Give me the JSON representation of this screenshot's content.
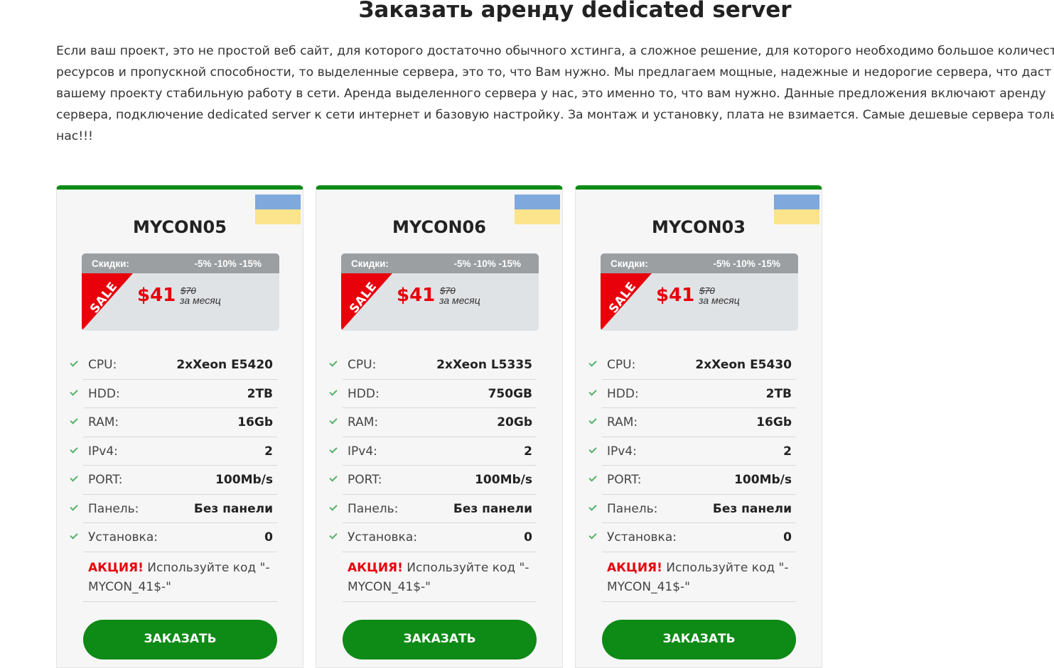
{
  "page": {
    "title": "Заказать аренду dedicated server",
    "intro": "Если ваш проект, это не простой веб сайт, для которого достаточно обычного хстинга, а сложное решение, для которого необходимо большое количест ресурсов и пропускной способности, то выделенные сервера, это то, что Вам нужно. Мы предлагаем мощные, надежные и недорогие сервера, что даст вашему проекту стабильную работу в сети. Аренда выделенного сервера у нас, это именно то, что вам нужно. Данные предложения включают аренду сервера, подключение dedicated server к сети интернет и базовую настройку. За монтаж и установку, плата не взимается. Самые дешевые сервера тольк нас!!!"
  },
  "colors": {
    "accent_green": "#0e8a16",
    "sale_red": "#e8000b",
    "flag_blue": "#7fa8dd",
    "flag_yellow": "#fbe48c"
  },
  "cards": [
    {
      "name": "MYCON05",
      "flag_icon": "ukraine-flag-icon",
      "discount_label": "Скидки:",
      "discount_values": "-5% -10% -15%",
      "sale_badge": "SALE",
      "price_new": "$41",
      "price_old": "$70",
      "price_period": "за месяц",
      "specs": [
        {
          "label": "CPU:",
          "value": "2xXeon E5420"
        },
        {
          "label": "HDD:",
          "value": "2TB"
        },
        {
          "label": "RAM:",
          "value": "16Gb"
        },
        {
          "label": "IPv4:",
          "value": "2"
        },
        {
          "label": "PORT:",
          "value": "100Mb/s"
        },
        {
          "label": "Панель:",
          "value": "Без панели"
        },
        {
          "label": "Установка:",
          "value": "0"
        }
      ],
      "promo_highlight": "АКЦИЯ!",
      "promo_text": " Используйте код \"-MYCON_41$-\"",
      "order_label": "ЗАКАЗАТЬ"
    },
    {
      "name": "MYCON06",
      "flag_icon": "ukraine-flag-icon",
      "discount_label": "Скидки:",
      "discount_values": "-5% -10% -15%",
      "sale_badge": "SALE",
      "price_new": "$41",
      "price_old": "$70",
      "price_period": "за месяц",
      "specs": [
        {
          "label": "CPU:",
          "value": "2xXeon L5335"
        },
        {
          "label": "HDD:",
          "value": "750GB"
        },
        {
          "label": "RAM:",
          "value": "20Gb"
        },
        {
          "label": "IPv4:",
          "value": "2"
        },
        {
          "label": "PORT:",
          "value": "100Mb/s"
        },
        {
          "label": "Панель:",
          "value": "Без панели"
        },
        {
          "label": "Установка:",
          "value": "0"
        }
      ],
      "promo_highlight": "АКЦИЯ!",
      "promo_text": " Используйте код \"-MYCON_41$-\"",
      "order_label": "ЗАКАЗАТЬ"
    },
    {
      "name": "MYCON03",
      "flag_icon": "ukraine-flag-icon",
      "discount_label": "Скидки:",
      "discount_values": "-5% -10% -15%",
      "sale_badge": "SALE",
      "price_new": "$41",
      "price_old": "$70",
      "price_period": "за месяц",
      "specs": [
        {
          "label": "CPU:",
          "value": "2xXeon E5430"
        },
        {
          "label": "HDD:",
          "value": "2TB"
        },
        {
          "label": "RAM:",
          "value": "16Gb"
        },
        {
          "label": "IPv4:",
          "value": "2"
        },
        {
          "label": "PORT:",
          "value": "100Mb/s"
        },
        {
          "label": "Панель:",
          "value": "Без панели"
        },
        {
          "label": "Установка:",
          "value": "0"
        }
      ],
      "promo_highlight": "АКЦИЯ!",
      "promo_text": " Используйте код \"-MYCON_41$-\"",
      "order_label": "ЗАКАЗАТЬ"
    }
  ]
}
